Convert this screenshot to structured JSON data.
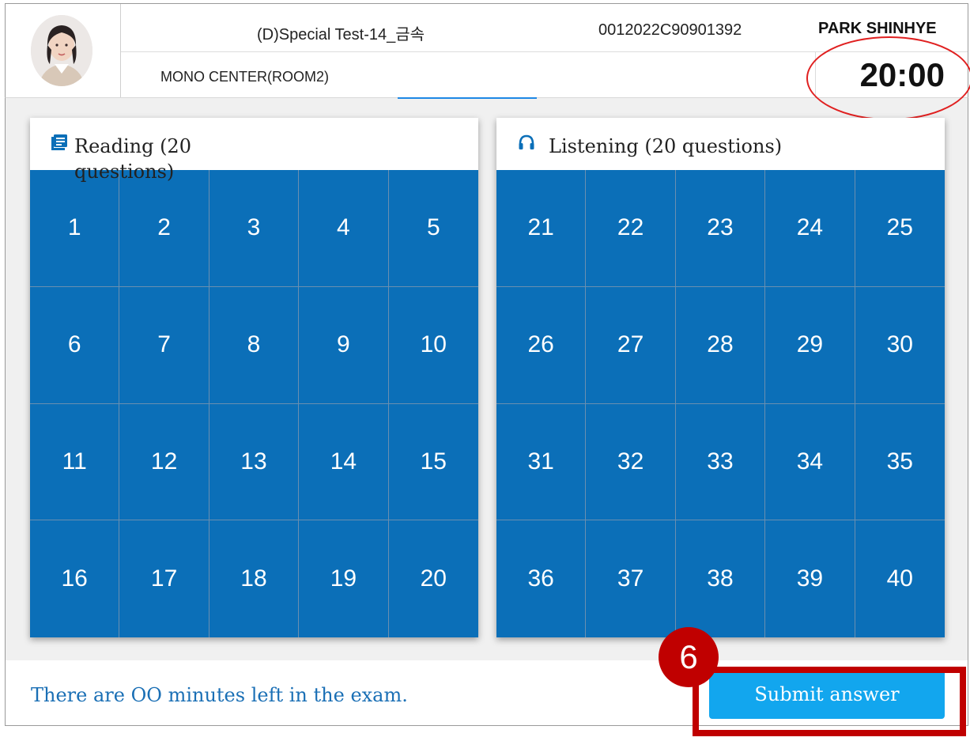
{
  "header": {
    "test_name": "(D)Special Test-14_금속",
    "exam_number": "0012022C90901392",
    "candidate_name": "PARK SHINHYE",
    "exam_center": "MONO CENTER(ROOM2)",
    "timer": "20:00"
  },
  "reading": {
    "title_line1": "Reading (20",
    "title_line2": "questions)",
    "icon": "book-icon",
    "questions": [
      "1",
      "2",
      "3",
      "4",
      "5",
      "6",
      "7",
      "8",
      "9",
      "10",
      "11",
      "12",
      "13",
      "14",
      "15",
      "16",
      "17",
      "18",
      "19",
      "20"
    ]
  },
  "listening": {
    "title": "Listening (20 questions)",
    "icon": "headphones-icon",
    "questions": [
      "21",
      "22",
      "23",
      "24",
      "25",
      "26",
      "27",
      "28",
      "29",
      "30",
      "31",
      "32",
      "33",
      "34",
      "35",
      "36",
      "37",
      "38",
      "39",
      "40"
    ]
  },
  "footer": {
    "message": "There are OO minutes left in the exam.",
    "submit_label": "Submit answer"
  },
  "annotations": {
    "step_number": "6",
    "highlight_color": "#c00000",
    "timer_ellipse_color": "#e02020"
  },
  "colors": {
    "grid_blue": "#0b6fb8",
    "submit_blue": "#12a6ee",
    "message_blue": "#1a6fb5"
  }
}
